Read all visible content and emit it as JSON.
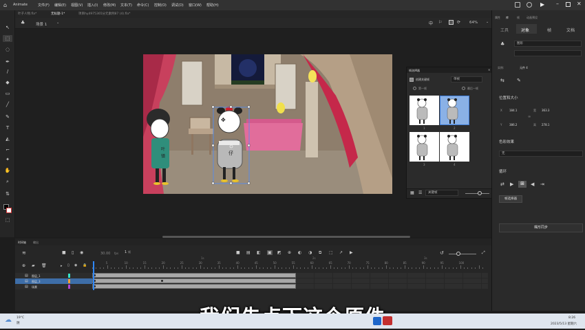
{
  "app": {
    "name": "Animate"
  },
  "menus": [
    "文件(F)",
    "编辑(E)",
    "视图(V)",
    "插入(I)",
    "修改(M)",
    "文本(T)",
    "命令(C)",
    "控制(O)",
    "调试(D)",
    "窗口(W)",
    "帮助(H)"
  ],
  "doc_tabs": [
    "叶子人物.fla*",
    "无标题-1*",
    "项目hy4975365分元素例87 (4).fla*"
  ],
  "scene": {
    "label": "场景 1",
    "zoom": "64%"
  },
  "swap_panel": {
    "title": "帧选择器",
    "create_keyframe_label": "创建关键帧",
    "mode_value": "单帧",
    "option_a": "第一帧",
    "option_b": "最后一帧",
    "thumb_numbers": [
      "1",
      "2",
      "3",
      "4"
    ],
    "bottom_select": "关键帧"
  },
  "right_panel": {
    "top_tabs": [
      "属性",
      "库",
      "帧",
      "动画预设"
    ],
    "tabs": [
      "工具",
      "对象",
      "帧",
      "文档"
    ],
    "symbol_type": "图形",
    "instance_label": "实例:",
    "instance_name": "元件 4",
    "pos_section": "位置和大小",
    "x_label": "X",
    "x_value": "184.1",
    "y_label": "Y",
    "y_value": "386.2",
    "w_label": "宽",
    "w_value": "363.3",
    "h_label": "高",
    "h_value": "278.1",
    "color_section": "色彩效果",
    "color_value": "无",
    "loop_section": "循环",
    "frame_picker_btn": "帧选择器",
    "sync_btn": "嘴形同步"
  },
  "timeline": {
    "tabs": [
      "时间轴",
      "输出"
    ],
    "fps": "30.00",
    "fps_unit": "fps",
    "frame_current": "1",
    "frame_unit": "帧",
    "ruler": [
      "5",
      "10",
      "15",
      "20",
      "25",
      "30",
      "35",
      "40",
      "45",
      "50",
      "55",
      "60",
      "65",
      "70",
      "75",
      "80",
      "85",
      "90",
      "95",
      "100"
    ],
    "ruler_seconds": [
      "1s",
      "2s",
      "3s"
    ],
    "layers": [
      {
        "name": "图层_1",
        "color": "#35e2c9"
      },
      {
        "name": "图层_3",
        "color": "#f7a02f"
      },
      {
        "name": "场景",
        "color": "#b544d4"
      }
    ]
  },
  "stage_char": {
    "pants_text": "仔",
    "shirt_text": "叶\n镇"
  },
  "subtitle": "我们先点下这个原件",
  "taskbar": {
    "weather_temp": "19°C",
    "weather_desc": "阴",
    "time": "8:26",
    "date": "2023/5/13 星期六"
  },
  "colors": {
    "accent": "#2d6cd0",
    "selection": "#3e7bd6",
    "frame_gray": "#a8a8a8"
  }
}
